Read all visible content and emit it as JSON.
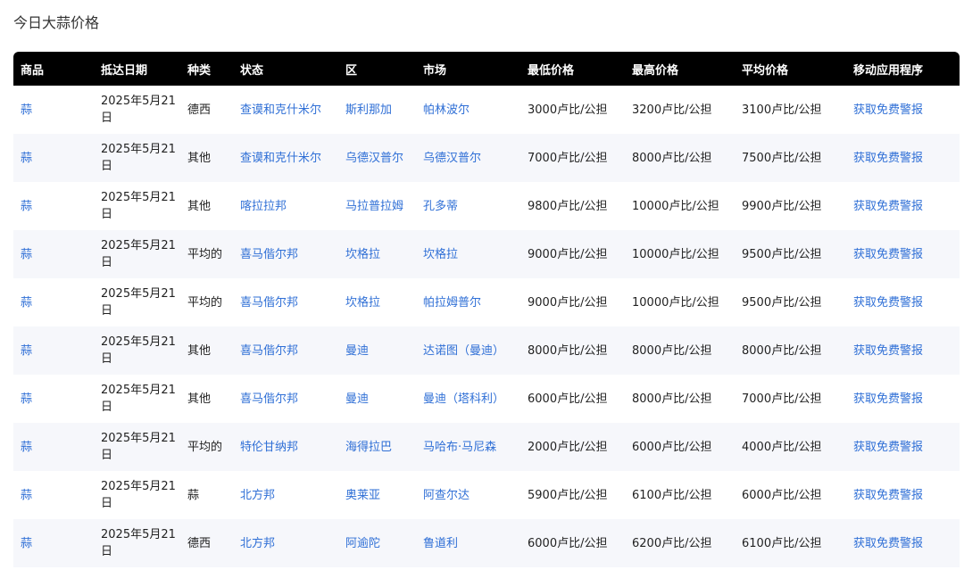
{
  "page": {
    "title": "今日大蒜价格"
  },
  "table": {
    "headers": [
      "商品",
      "抵达日期",
      "种类",
      "状态",
      "区",
      "市场",
      "最低价格",
      "最高价格",
      "平均价格",
      "移动应用程序"
    ],
    "rows": [
      {
        "commodity": "蒜",
        "date": "2025年5月21日",
        "variety": "德西",
        "state": "查谟和克什米尔",
        "district": "斯利那加",
        "market": "帕林波尔",
        "min": "3000卢比/公担",
        "max": "3200卢比/公担",
        "avg": "3100卢比/公担",
        "app": "获取免费警报"
      },
      {
        "commodity": "蒜",
        "date": "2025年5月21日",
        "variety": "其他",
        "state": "查谟和克什米尔",
        "district": "乌德汉普尔",
        "market": "乌德汉普尔",
        "min": "7000卢比/公担",
        "max": "8000卢比/公担",
        "avg": "7500卢比/公担",
        "app": "获取免费警报"
      },
      {
        "commodity": "蒜",
        "date": "2025年5月21日",
        "variety": "其他",
        "state": "喀拉拉邦",
        "district": "马拉普拉姆",
        "market": "孔多蒂",
        "min": "9800卢比/公担",
        "max": "10000卢比/公担",
        "avg": "9900卢比/公担",
        "app": "获取免费警报"
      },
      {
        "commodity": "蒜",
        "date": "2025年5月21日",
        "variety": "平均的",
        "state": "喜马偕尔邦",
        "district": "坎格拉",
        "market": "坎格拉",
        "min": "9000卢比/公担",
        "max": "10000卢比/公担",
        "avg": "9500卢比/公担",
        "app": "获取免费警报"
      },
      {
        "commodity": "蒜",
        "date": "2025年5月21日",
        "variety": "平均的",
        "state": "喜马偕尔邦",
        "district": "坎格拉",
        "market": "帕拉姆普尔",
        "min": "9000卢比/公担",
        "max": "10000卢比/公担",
        "avg": "9500卢比/公担",
        "app": "获取免费警报"
      },
      {
        "commodity": "蒜",
        "date": "2025年5月21日",
        "variety": "其他",
        "state": "喜马偕尔邦",
        "district": "曼迪",
        "market": "达诺图（曼迪）",
        "min": "8000卢比/公担",
        "max": "8000卢比/公担",
        "avg": "8000卢比/公担",
        "app": "获取免费警报"
      },
      {
        "commodity": "蒜",
        "date": "2025年5月21日",
        "variety": "其他",
        "state": "喜马偕尔邦",
        "district": "曼迪",
        "market": "曼迪（塔科利）",
        "min": "6000卢比/公担",
        "max": "8000卢比/公担",
        "avg": "7000卢比/公担",
        "app": "获取免费警报"
      },
      {
        "commodity": "蒜",
        "date": "2025年5月21日",
        "variety": "平均的",
        "state": "特伦甘纳邦",
        "district": "海得拉巴",
        "market": "马哈布·马尼森",
        "min": "2000卢比/公担",
        "max": "6000卢比/公担",
        "avg": "4000卢比/公担",
        "app": "获取免费警报"
      },
      {
        "commodity": "蒜",
        "date": "2025年5月21日",
        "variety": "蒜",
        "state": "北方邦",
        "district": "奥莱亚",
        "market": "阿查尔达",
        "min": "5900卢比/公担",
        "max": "6100卢比/公担",
        "avg": "6000卢比/公担",
        "app": "获取免费警报"
      },
      {
        "commodity": "蒜",
        "date": "2025年5月21日",
        "variety": "德西",
        "state": "北方邦",
        "district": "阿逾陀",
        "market": "鲁道利",
        "min": "6000卢比/公担",
        "max": "6200卢比/公担",
        "avg": "6100卢比/公担",
        "app": "获取免费警报"
      }
    ]
  },
  "colors": {
    "header_bg": "#000000",
    "link": "#2f6fd6",
    "stripe": "#f6f7fb"
  }
}
